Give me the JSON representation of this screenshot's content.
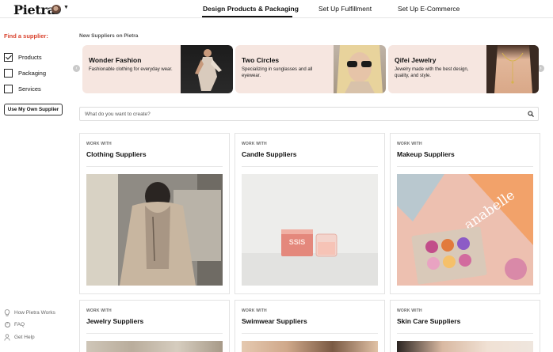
{
  "header": {
    "logo": "Pietra",
    "nav": [
      {
        "label": "Design Products & Packaging",
        "active": true
      },
      {
        "label": "Set Up Fulfillment",
        "active": false
      },
      {
        "label": "Set Up E-Commerce",
        "active": false
      }
    ]
  },
  "sidebar": {
    "title": "Find a supplier:",
    "filters": [
      {
        "label": "Products",
        "checked": true
      },
      {
        "label": "Packaging",
        "checked": false
      },
      {
        "label": "Services",
        "checked": false
      }
    ],
    "own_supplier_button": "Use My Own Supplier",
    "links": [
      {
        "label": "How Pietra Works",
        "icon": "lightbulb-icon"
      },
      {
        "label": "FAQ",
        "icon": "question-icon"
      },
      {
        "label": "Get Help",
        "icon": "person-icon"
      }
    ]
  },
  "main": {
    "new_suppliers_title": "New Suppliers on Pietra",
    "featured": [
      {
        "name": "Wonder Fashion",
        "description": "Fashionable clothing for everyday wear."
      },
      {
        "name": "Two Circles",
        "description": "Specializing in sunglasses and all eyewear."
      },
      {
        "name": "Qifei Jewelry",
        "description": "Jewelry made with the best design, quality, and style."
      }
    ],
    "search": {
      "placeholder": "What do you want to create?",
      "value": ""
    },
    "categories": [
      {
        "kicker": "WORK WITH",
        "title": "Clothing Suppliers"
      },
      {
        "kicker": "WORK WITH",
        "title": "Candle Suppliers"
      },
      {
        "kicker": "WORK WITH",
        "title": "Makeup Suppliers"
      },
      {
        "kicker": "WORK WITH",
        "title": "Jewelry Suppliers"
      },
      {
        "kicker": "WORK WITH",
        "title": "Swimwear Suppliers"
      },
      {
        "kicker": "WORK WITH",
        "title": "Skin Care Suppliers"
      }
    ],
    "image_text": {
      "candle_label": "SSIS",
      "makeup_brand": "anabelle"
    }
  },
  "colors": {
    "accent": "#d9432e",
    "feature_bg": "#f6e6e0",
    "text": "#111111"
  }
}
